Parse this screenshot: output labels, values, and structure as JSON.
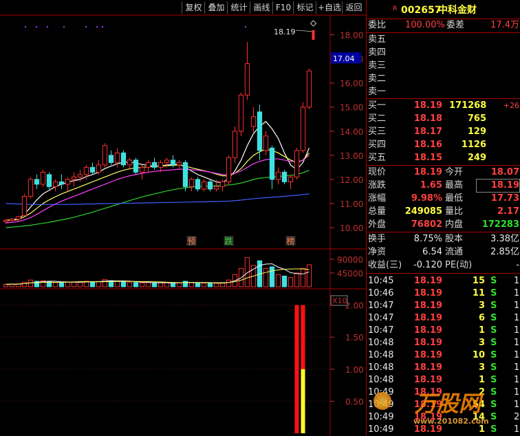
{
  "toolbar": {
    "buttons": [
      "复权",
      "叠加",
      "统计",
      "画线",
      "F10",
      "标记",
      "+自选",
      "返回"
    ]
  },
  "stock": {
    "flag": "R",
    "code": "002657",
    "name": "中科金财"
  },
  "weibi": {
    "label": "委比",
    "value": "100.00%",
    "label2": "委差",
    "value2": "17.4万"
  },
  "sell_levels": [
    "卖五",
    "卖四",
    "卖三",
    "卖二",
    "卖一"
  ],
  "buy_levels": [
    {
      "label": "买一",
      "price": "18.19",
      "vol": "171268",
      "chg": "+26"
    },
    {
      "label": "买二",
      "price": "18.18",
      "vol": "765",
      "chg": ""
    },
    {
      "label": "买三",
      "price": "18.17",
      "vol": "129",
      "chg": ""
    },
    {
      "label": "买四",
      "price": "18.16",
      "vol": "1126",
      "chg": ""
    },
    {
      "label": "买五",
      "price": "18.15",
      "vol": "249",
      "chg": ""
    }
  ],
  "quote": [
    {
      "l1": "现价",
      "v1": "18.19",
      "c1": "red",
      "l2": "今开",
      "v2": "18.07",
      "c2": "red"
    },
    {
      "l1": "涨跌",
      "v1": "1.65",
      "c1": "red",
      "l2": "最高",
      "v2": "18.19",
      "c2": "red"
    },
    {
      "l1": "涨幅",
      "v1": "9.98%",
      "c1": "red",
      "l2": "最低",
      "v2": "17.73",
      "c2": "red"
    },
    {
      "l1": "总量",
      "v1": "249085",
      "c1": "yellow",
      "l2": "量比",
      "v2": "2.17",
      "c2": "red"
    },
    {
      "l1": "外盘",
      "v1": "76802",
      "c1": "red",
      "l2": "内盘",
      "v2": "172283",
      "c2": "green"
    }
  ],
  "fundamentals": [
    {
      "l1": "换手",
      "v1": "8.75%",
      "l2": "股本",
      "v2": "3.38亿"
    },
    {
      "l1": "净资",
      "v1": "6.54",
      "l2": "流通",
      "v2": "2.85亿"
    },
    {
      "l1": "收益(三)",
      "v1": "-0.120",
      "l2": "PE(动)",
      "v2": "-"
    }
  ],
  "ticks": [
    {
      "time": "10:45",
      "price": "18.19",
      "vol": "15",
      "side": "S",
      "n": "1"
    },
    {
      "time": "10:46",
      "price": "18.19",
      "vol": "11",
      "side": "S",
      "n": "1"
    },
    {
      "time": "10:47",
      "price": "18.19",
      "vol": "3",
      "side": "S",
      "n": "1"
    },
    {
      "time": "10:47",
      "price": "18.19",
      "vol": "6",
      "side": "S",
      "n": "1"
    },
    {
      "time": "10:47",
      "price": "18.19",
      "vol": "1",
      "side": "S",
      "n": "1"
    },
    {
      "time": "10:48",
      "price": "18.19",
      "vol": "3",
      "side": "S",
      "n": "1"
    },
    {
      "time": "10:48",
      "price": "18.19",
      "vol": "10",
      "side": "S",
      "n": "1"
    },
    {
      "time": "10:48",
      "price": "18.19",
      "vol": "3",
      "side": "S",
      "n": "1"
    },
    {
      "time": "10:48",
      "price": "18.19",
      "vol": "1",
      "side": "S",
      "n": "1"
    },
    {
      "time": "10:49",
      "price": "18.19",
      "vol": "2",
      "side": "S",
      "n": "1"
    },
    {
      "time": "10:49",
      "price": "18.19",
      "vol": "54",
      "side": "S",
      "n": "1"
    },
    {
      "time": "10:49",
      "price": "18.19",
      "vol": "14",
      "side": "S",
      "n": "2"
    },
    {
      "time": "10:49",
      "price": "18.19",
      "vol": "1",
      "side": "S",
      "n": "1"
    }
  ],
  "watermark": {
    "text": "万股网",
    "url": "www.201082.com"
  },
  "chart_data": {
    "type": "candlestick",
    "price_axis": {
      "ticks": [
        18.0,
        17.0,
        16.0,
        15.0,
        14.0,
        13.0,
        12.0,
        11.0,
        10.0
      ],
      "ylim": [
        9.6,
        18.7
      ],
      "current_label": "17.04",
      "high_annotation": "18.19"
    },
    "candles": [
      [
        10.25,
        10.35,
        10.15,
        10.3
      ],
      [
        10.3,
        10.4,
        10.2,
        10.35
      ],
      [
        10.35,
        10.5,
        10.25,
        10.45
      ],
      [
        10.5,
        11.4,
        10.45,
        11.3
      ],
      [
        11.3,
        12.1,
        11.2,
        12.0
      ],
      [
        12.0,
        12.2,
        11.6,
        11.8
      ],
      [
        11.8,
        12.4,
        11.7,
        12.3
      ],
      [
        12.2,
        12.3,
        11.6,
        11.7
      ],
      [
        11.7,
        12.0,
        11.5,
        11.9
      ],
      [
        11.9,
        12.2,
        11.6,
        11.8
      ],
      [
        11.8,
        12.1,
        11.5,
        12.0
      ],
      [
        12.0,
        12.3,
        11.7,
        12.1
      ],
      [
        12.1,
        12.4,
        11.9,
        12.2
      ],
      [
        12.2,
        12.6,
        12.0,
        12.5
      ],
      [
        12.5,
        12.7,
        12.2,
        12.3
      ],
      [
        12.3,
        12.8,
        12.2,
        12.6
      ],
      [
        12.6,
        13.5,
        12.5,
        13.4
      ],
      [
        13.0,
        13.2,
        12.6,
        12.7
      ],
      [
        12.7,
        13.3,
        12.5,
        13.1
      ],
      [
        13.1,
        13.2,
        12.5,
        12.6
      ],
      [
        12.6,
        12.9,
        12.4,
        12.8
      ],
      [
        12.8,
        12.9,
        12.2,
        12.3
      ],
      [
        12.3,
        12.6,
        12.0,
        12.5
      ],
      [
        12.5,
        12.8,
        12.3,
        12.7
      ],
      [
        12.7,
        12.9,
        12.4,
        12.5
      ],
      [
        12.5,
        12.8,
        12.3,
        12.7
      ],
      [
        12.7,
        12.9,
        12.5,
        12.8
      ],
      [
        12.8,
        13.0,
        12.5,
        12.6
      ],
      [
        12.6,
        12.8,
        12.4,
        12.7
      ],
      [
        12.7,
        12.8,
        11.5,
        11.7
      ],
      [
        11.7,
        12.1,
        11.5,
        12.0
      ],
      [
        12.0,
        12.1,
        11.5,
        11.6
      ],
      [
        11.6,
        12.0,
        11.5,
        11.9
      ],
      [
        11.9,
        12.0,
        11.5,
        11.6
      ],
      [
        11.6,
        12.0,
        11.5,
        11.7
      ],
      [
        11.7,
        12.0,
        11.5,
        11.9
      ],
      [
        11.9,
        13.0,
        11.8,
        12.9
      ],
      [
        12.9,
        14.2,
        12.7,
        14.0
      ],
      [
        14.0,
        15.6,
        13.8,
        15.5
      ],
      [
        15.5,
        17.7,
        15.3,
        16.8
      ],
      [
        14.2,
        15.0,
        13.9,
        14.6
      ],
      [
        14.8,
        15.1,
        12.8,
        13.2
      ],
      [
        13.2,
        14.0,
        13.0,
        13.8
      ],
      [
        13.3,
        13.4,
        11.6,
        12.0
      ],
      [
        12.0,
        12.5,
        11.8,
        12.3
      ],
      [
        12.3,
        12.4,
        11.8,
        11.9
      ],
      [
        11.9,
        12.2,
        11.6,
        12.1
      ],
      [
        12.1,
        13.3,
        12.0,
        13.2
      ],
      [
        13.2,
        15.2,
        13.1,
        15.0
      ],
      [
        15.0,
        16.6,
        14.9,
        16.5
      ]
    ],
    "ma_lines": [
      {
        "color": "#ffffff",
        "values": [
          10.3,
          10.33,
          10.37,
          10.55,
          10.85,
          11.15,
          11.4,
          11.55,
          11.7,
          11.8,
          11.88,
          11.95,
          12.0,
          12.12,
          12.2,
          12.3,
          12.45,
          12.55,
          12.65,
          12.7,
          12.72,
          12.68,
          12.62,
          12.58,
          12.55,
          12.56,
          12.6,
          12.62,
          12.64,
          12.5,
          12.35,
          12.2,
          12.1,
          12.0,
          11.9,
          11.85,
          12.05,
          12.35,
          12.8,
          13.4,
          13.9,
          14.2,
          14.4,
          14.1,
          13.7,
          13.1,
          12.6,
          12.4,
          12.7,
          13.3
        ]
      },
      {
        "color": "#ffff60",
        "values": [
          10.3,
          10.31,
          10.33,
          10.45,
          10.6,
          10.8,
          11.0,
          11.15,
          11.28,
          11.4,
          11.5,
          11.6,
          11.7,
          11.8,
          11.9,
          12.0,
          12.1,
          12.2,
          12.3,
          12.38,
          12.44,
          12.48,
          12.5,
          12.52,
          12.54,
          12.55,
          12.57,
          12.58,
          12.6,
          12.55,
          12.48,
          12.42,
          12.36,
          12.3,
          12.22,
          12.15,
          12.15,
          12.25,
          12.45,
          12.75,
          13.0,
          13.15,
          13.25,
          13.2,
          13.1,
          12.95,
          12.8,
          12.7,
          12.8,
          13.1
        ]
      },
      {
        "color": "#ff40ff",
        "values": [
          10.2,
          10.22,
          10.25,
          10.32,
          10.42,
          10.55,
          10.7,
          10.85,
          10.98,
          11.1,
          11.2,
          11.3,
          11.4,
          11.5,
          11.6,
          11.7,
          11.8,
          11.9,
          12.0,
          12.08,
          12.15,
          12.2,
          12.25,
          12.3,
          12.33,
          12.36,
          12.38,
          12.4,
          12.42,
          12.42,
          12.4,
          12.38,
          12.35,
          12.3,
          12.25,
          12.2,
          12.2,
          12.25,
          12.35,
          12.5,
          12.65,
          12.75,
          12.82,
          12.85,
          12.85,
          12.8,
          12.75,
          12.72,
          12.8,
          13.0
        ]
      },
      {
        "color": "#30d030",
        "values": [
          10.0,
          10.02,
          10.04,
          10.07,
          10.1,
          10.14,
          10.18,
          10.22,
          10.27,
          10.32,
          10.37,
          10.43,
          10.5,
          10.57,
          10.64,
          10.72,
          10.8,
          10.88,
          10.96,
          11.04,
          11.12,
          11.2,
          11.27,
          11.34,
          11.4,
          11.46,
          11.52,
          11.57,
          11.62,
          11.65,
          11.68,
          11.7,
          11.72,
          11.73,
          11.74,
          11.75,
          11.77,
          11.8,
          11.85,
          11.92,
          12.0,
          12.05,
          12.08,
          12.1,
          12.12,
          12.14,
          12.17,
          12.2,
          12.28,
          12.38
        ]
      },
      {
        "color": "#4060ff",
        "values": [
          11.0,
          10.99,
          10.98,
          10.97,
          10.96,
          10.96,
          10.96,
          10.96,
          10.96,
          10.96,
          10.96,
          10.97,
          10.97,
          10.98,
          10.98,
          10.99,
          10.99,
          11.0,
          11.0,
          11.01,
          11.01,
          11.02,
          11.02,
          11.03,
          11.03,
          11.04,
          11.04,
          11.05,
          11.05,
          11.06,
          11.06,
          11.07,
          11.07,
          11.08,
          11.08,
          11.09,
          11.1,
          11.12,
          11.14,
          11.17,
          11.2,
          11.22,
          11.24,
          11.26,
          11.28,
          11.3,
          11.32,
          11.34,
          11.37,
          11.4
        ]
      }
    ],
    "signals": [
      {
        "label": "预",
        "candle": 30,
        "color": "#ff8040"
      },
      {
        "label": "跌",
        "candle": 36,
        "color": "#30e030"
      },
      {
        "label": "榜",
        "candle": 46,
        "color": "#ff8040"
      }
    ],
    "volume": {
      "ticks": [
        90000,
        45000
      ],
      "unit_label": "X10",
      "ylim": [
        0,
        110000
      ],
      "values": [
        8000,
        9000,
        9500,
        15000,
        22000,
        18000,
        20000,
        16000,
        14000,
        13000,
        15000,
        16000,
        17000,
        18000,
        16000,
        17000,
        24000,
        20000,
        18000,
        16000,
        15000,
        14000,
        13000,
        14000,
        12000,
        13000,
        14000,
        12000,
        13000,
        18000,
        14000,
        13000,
        12000,
        12000,
        11000,
        12000,
        22000,
        40000,
        60000,
        95000,
        70000,
        85000,
        60000,
        65000,
        40000,
        35000,
        30000,
        45000,
        60000,
        72000
      ]
    },
    "indicator": {
      "ticks": [
        2.0,
        1.5,
        1.0,
        0.5
      ],
      "ylim": [
        0,
        2.2
      ],
      "bars": [
        {
          "candle": 47,
          "red": 2.0,
          "yellow": 0
        },
        {
          "candle": 48,
          "red": 2.0,
          "yellow": 1.0
        }
      ]
    }
  }
}
